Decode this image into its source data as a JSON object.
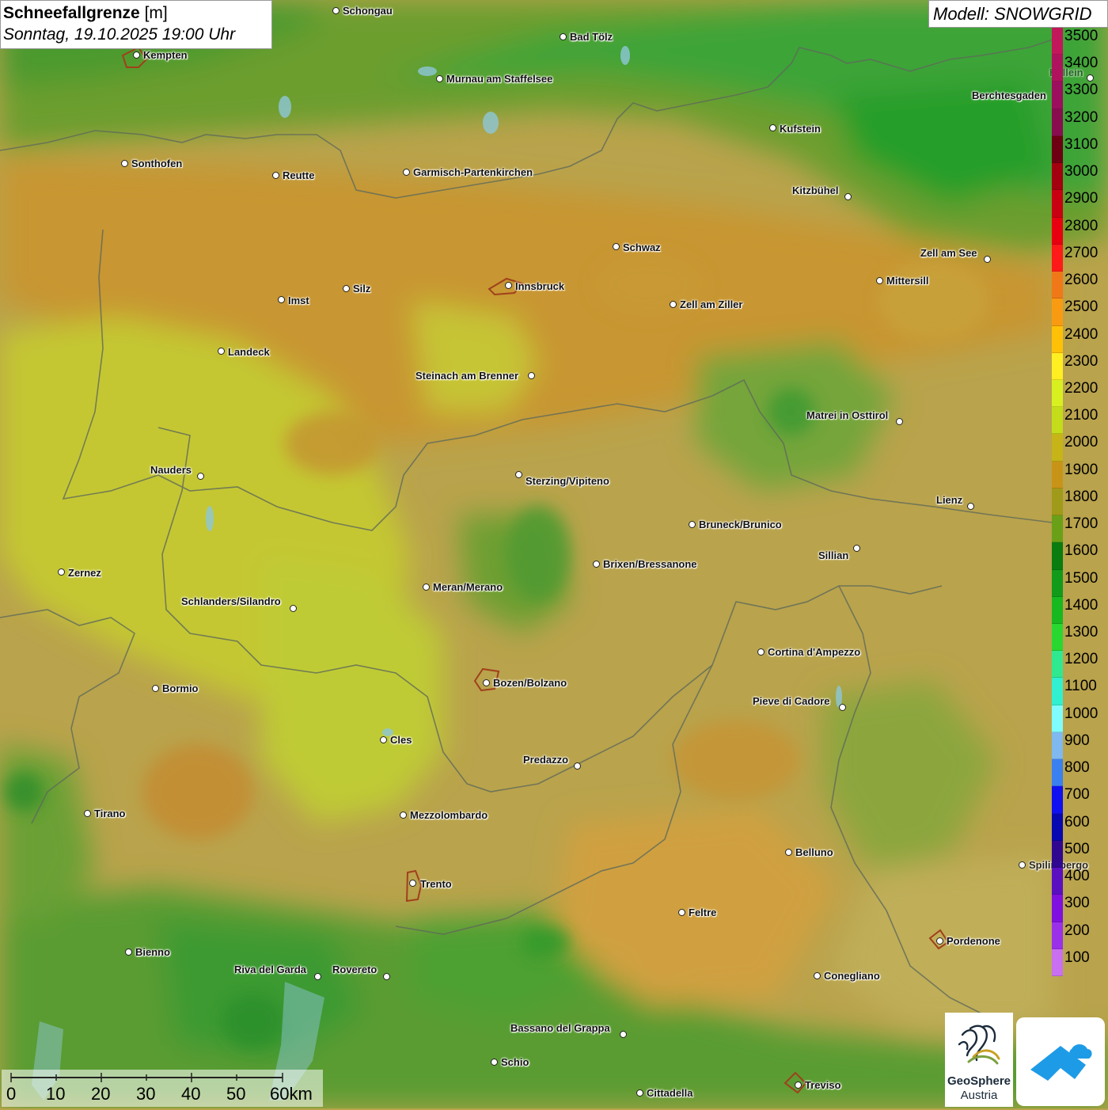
{
  "header": {
    "title_bold": "Schneefallgrenze",
    "title_unit": "[m]",
    "subtitle": "Sonntag, 19.10.2025 19:00 Uhr"
  },
  "model_label": "Modell: SNOWGRID",
  "legend": {
    "levels": [
      {
        "label": "3500",
        "color": "#c2185b"
      },
      {
        "label": "3400",
        "color": "#b0135d"
      },
      {
        "label": "3300",
        "color": "#9c0f5e"
      },
      {
        "label": "3200",
        "color": "#880e4f"
      },
      {
        "label": "3100",
        "color": "#6d0012"
      },
      {
        "label": "3000",
        "color": "#a30010"
      },
      {
        "label": "2900",
        "color": "#c80012"
      },
      {
        "label": "2800",
        "color": "#e80010"
      },
      {
        "label": "2700",
        "color": "#ff1a1a"
      },
      {
        "label": "2600",
        "color": "#f07818"
      },
      {
        "label": "2500",
        "color": "#f89b12"
      },
      {
        "label": "2400",
        "color": "#ffc107"
      },
      {
        "label": "2300",
        "color": "#ffee22"
      },
      {
        "label": "2200",
        "color": "#d8f020"
      },
      {
        "label": "2100",
        "color": "#c4dc1a"
      },
      {
        "label": "2000",
        "color": "#c6b418"
      },
      {
        "label": "1900",
        "color": "#c89418"
      },
      {
        "label": "1800",
        "color": "#a09a1a"
      },
      {
        "label": "1700",
        "color": "#6aa018"
      },
      {
        "label": "1600",
        "color": "#0a7c10"
      },
      {
        "label": "1500",
        "color": "#129a1a"
      },
      {
        "label": "1400",
        "color": "#18b820"
      },
      {
        "label": "1300",
        "color": "#28d830"
      },
      {
        "label": "1200",
        "color": "#30e890"
      },
      {
        "label": "1100",
        "color": "#30f0d0"
      },
      {
        "label": "1000",
        "color": "#80fcfc"
      },
      {
        "label": "900",
        "color": "#80b8f0"
      },
      {
        "label": "800",
        "color": "#3a80f0"
      },
      {
        "label": "700",
        "color": "#1010f0"
      },
      {
        "label": "600",
        "color": "#0808b0"
      },
      {
        "label": "500",
        "color": "#300890"
      },
      {
        "label": "400",
        "color": "#5a10c0"
      },
      {
        "label": "300",
        "color": "#8010e0"
      },
      {
        "label": "200",
        "color": "#9a30e8"
      },
      {
        "label": "100",
        "color": "#c870f0"
      }
    ]
  },
  "cities": [
    {
      "name": "Schongau"
    },
    {
      "name": "Bad Tölz"
    },
    {
      "name": "Kempten"
    },
    {
      "name": "Murnau am Staffelsee"
    },
    {
      "name": "Hallein"
    },
    {
      "name": "Berchtesgaden"
    },
    {
      "name": "Kufstein"
    },
    {
      "name": "Sonthofen"
    },
    {
      "name": "Reutte"
    },
    {
      "name": "Garmisch-Partenkirchen"
    },
    {
      "name": "Kitzbühel"
    },
    {
      "name": "Schwaz"
    },
    {
      "name": "Zell am See"
    },
    {
      "name": "Innsbruck"
    },
    {
      "name": "Mittersill"
    },
    {
      "name": "Silz"
    },
    {
      "name": "Imst"
    },
    {
      "name": "Zell am Ziller"
    },
    {
      "name": "Landeck"
    },
    {
      "name": "Steinach am Brenner"
    },
    {
      "name": "Matrei in Osttirol"
    },
    {
      "name": "Nauders"
    },
    {
      "name": "Sterzing/Vipiteno"
    },
    {
      "name": "Lienz"
    },
    {
      "name": "Bruneck/Brunico"
    },
    {
      "name": "Sillian"
    },
    {
      "name": "Brixen/Bressanone"
    },
    {
      "name": "Zernez"
    },
    {
      "name": "Meran/Merano"
    },
    {
      "name": "Schlanders/Silandro"
    },
    {
      "name": "Cortina d'Ampezzo"
    },
    {
      "name": "Bozen/Bolzano"
    },
    {
      "name": "Bormio"
    },
    {
      "name": "Pieve di Cadore"
    },
    {
      "name": "Cles"
    },
    {
      "name": "Predazzo"
    },
    {
      "name": "Tirano"
    },
    {
      "name": "Mezzolombardo"
    },
    {
      "name": "Belluno"
    },
    {
      "name": "Spilimbergo"
    },
    {
      "name": "Trento"
    },
    {
      "name": "Feltre"
    },
    {
      "name": "Pordenone"
    },
    {
      "name": "Bienno"
    },
    {
      "name": "Riva del Garda"
    },
    {
      "name": "Rovereto"
    },
    {
      "name": "Conegliano"
    },
    {
      "name": "Bassano del Grappa"
    },
    {
      "name": "Schio"
    },
    {
      "name": "Treviso"
    },
    {
      "name": "Cittadella"
    }
  ],
  "scalebar": {
    "labels": [
      "0",
      "10",
      "20",
      "30",
      "40",
      "50",
      "60km"
    ]
  },
  "logo": {
    "line1": "GeoSphere",
    "line2": "Austria"
  }
}
